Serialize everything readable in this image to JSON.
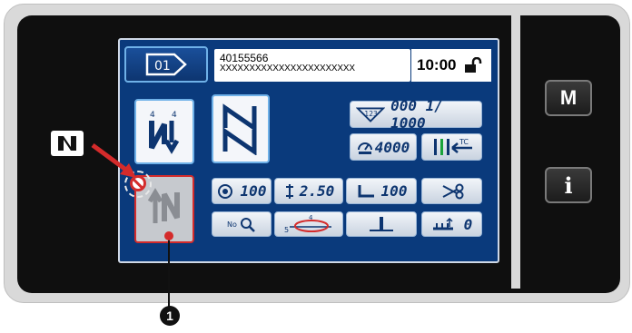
{
  "header": {
    "pattern_number": "40155566",
    "pattern_name": "XXXXXXXXXXXXXXXXXXXXXXX",
    "time": "10:00"
  },
  "counter": {
    "value": "000 1/ 1000"
  },
  "speed": {
    "value": "4000"
  },
  "params": {
    "thread_tension": "100",
    "stitch_length": "2.50",
    "presser_pressure": "100",
    "last_value": "0"
  },
  "side_buttons": {
    "menu": "M",
    "info": "i"
  },
  "callout": {
    "number": "1"
  },
  "colors": {
    "screen": "#0a3a7c",
    "accent_border": "#6fb1e8",
    "disabled_red": "#d42b2b",
    "callout_red": "#d42b2b"
  }
}
